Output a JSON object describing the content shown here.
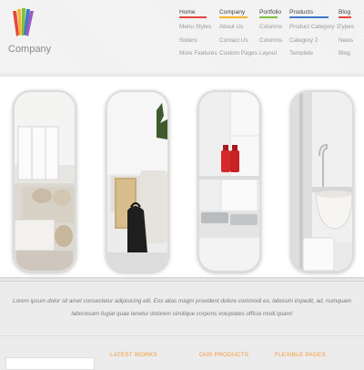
{
  "brand": {
    "name": "Company"
  },
  "nav": [
    {
      "label": "Home",
      "color": "#e3483d",
      "items": [
        "Menu Styles",
        "Sliders",
        "More Features"
      ]
    },
    {
      "label": "Company",
      "color": "#f5b52e",
      "items": [
        "About Us",
        "Contact Us",
        "Custom Pages"
      ]
    },
    {
      "label": "Portfolio",
      "color": "#7dc142",
      "items": [
        "Columns",
        "Columns",
        "Layout"
      ]
    },
    {
      "label": "Products",
      "color": "#3d78c9",
      "items": [
        "Product Category 1",
        "Category 2",
        "Template"
      ]
    },
    {
      "label": "Blog",
      "color": "#e3483d",
      "items": [
        "Types",
        "News",
        "Blog"
      ]
    }
  ],
  "gallery": {
    "cards": [
      "living-room",
      "bedroom-with-bag",
      "kitchen",
      "bathroom"
    ]
  },
  "intro_text": "Lorem ipsum dolor sit amet consectetur adipisicing elit. Eos alias magni provident dolore commodi ex, laborum impedit, ad, numquam laboriosam fugiat quae tenetur dolorem similique corporis voluptates officia modi quam!",
  "footer": {
    "headings": [
      "LATEST WORKS",
      "OUR PRODUCTS",
      "FLEXIBLE PAGES"
    ]
  },
  "colors": {
    "accent_orange": "#f39a3a",
    "nav_red": "#e3483d",
    "nav_yellow": "#f5b52e",
    "nav_green": "#7dc142",
    "nav_blue": "#3d78c9"
  }
}
